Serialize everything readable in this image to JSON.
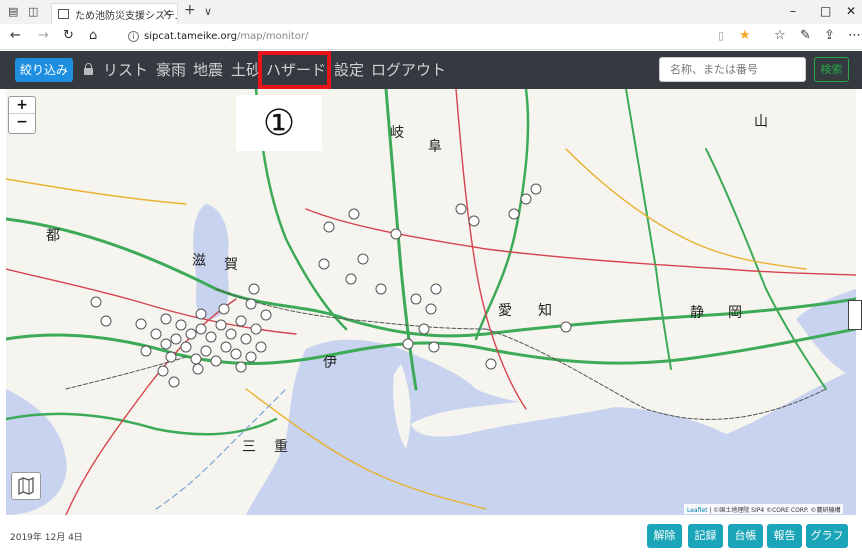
{
  "browser": {
    "tab_title": "ため池防災支援システム |",
    "tab_close": "×",
    "new_tab": "+",
    "tab_menu": "∨",
    "url_host": "sipcat.tameike.org",
    "url_path": "/map/monitor/",
    "window_minimize": "–",
    "window_maximize": "□",
    "window_close": "✕"
  },
  "navbar": {
    "narrow_button": "絞り込み",
    "links": [
      "リスト",
      "豪雨",
      "地震",
      "土砂",
      "ハザード",
      "設定",
      "ログアウト"
    ],
    "highlight_color": "#e8141a",
    "search_placeholder": "名称、または番号",
    "search_button": "検索"
  },
  "map": {
    "zoom_in": "+",
    "zoom_out": "−",
    "annotation": "①",
    "attribution_leaflet": "Leaflet",
    "attribution_text": " | ©国土地理院 SIP4 ©CORE CORP. ©農研機構",
    "place_labels": [
      "岐",
      "阜",
      "都",
      "滋",
      "賀",
      "愛",
      "知",
      "静",
      "岡",
      "三",
      "重",
      "伊",
      "山"
    ]
  },
  "footer": {
    "date": "2019年 12月 4日",
    "buttons": [
      "解除",
      "記録",
      "台帳",
      "報告",
      "グラフ"
    ]
  },
  "colors": {
    "navbar_bg": "#343a40",
    "primary": "#1e8fe0",
    "success": "#28a745",
    "footer_button": "#1aa5b8",
    "sea": "#c8d3f0",
    "land": "#f6f4ee"
  }
}
